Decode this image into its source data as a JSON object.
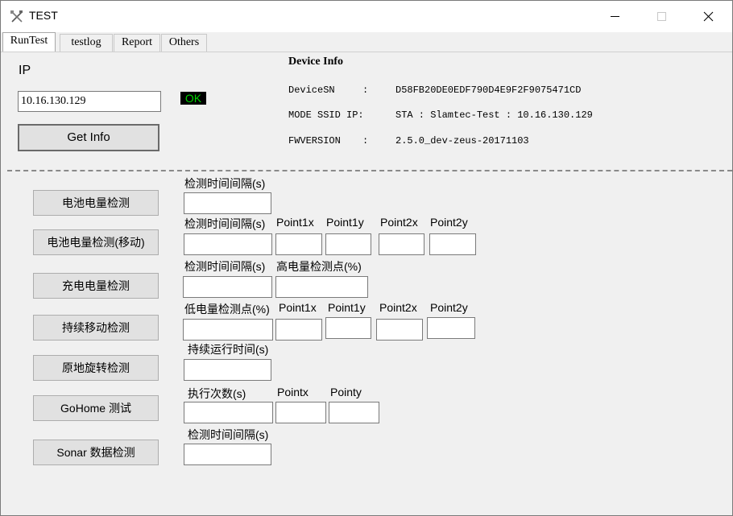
{
  "window": {
    "title": "TEST",
    "icon": "tools-icon",
    "controls": {
      "minimize": "minimize-icon",
      "maximize": "maximize-icon",
      "close": "close-icon"
    }
  },
  "tabs": [
    {
      "label": "RunTest",
      "active": true
    },
    {
      "label": "testlog",
      "active": false
    },
    {
      "label": "Report",
      "active": false
    },
    {
      "label": "Others",
      "active": false
    }
  ],
  "ip_section": {
    "label": "IP",
    "value": "10.16.130.129",
    "status": "OK",
    "status_color": "#00d200",
    "button": "Get Info"
  },
  "device_info": {
    "heading": "Device Info",
    "rows": [
      {
        "key": "DeviceSN",
        "sep": ":",
        "value": "D58FB20DE0EDF790D4E9F2F9075471CD"
      },
      {
        "key": "MODE SSID IP:",
        "sep": "",
        "value": "STA : Slamtec-Test : 10.16.130.129"
      },
      {
        "key": "FWVERSION",
        "sep": ":",
        "value": "2.5.0_dev-zeus-20171103"
      }
    ]
  },
  "tests": [
    {
      "button": "电池电量检测",
      "params": [
        "检测时间间隔(s)"
      ]
    },
    {
      "button": "电池电量检测(移动)",
      "params": [
        "检测时间间隔(s)",
        "Point1x",
        "Point1y",
        "Point2x",
        "Point2y"
      ]
    },
    {
      "button": "充电电量检测",
      "params": [
        "检测时间间隔(s)",
        "高电量检测点(%)"
      ]
    },
    {
      "button": "持续移动检测",
      "params": [
        "低电量检测点(%)",
        "Point1x",
        "Point1y",
        "Point2x",
        "Point2y"
      ]
    },
    {
      "button": "原地旋转检测",
      "params": [
        "持续运行时间(s)"
      ]
    },
    {
      "button": "GoHome 测试",
      "params": [
        "执行次数(s)",
        "Pointx",
        "Pointy"
      ]
    },
    {
      "button": "Sonar 数据检测",
      "params": [
        "检测时间间隔(s)"
      ]
    }
  ]
}
